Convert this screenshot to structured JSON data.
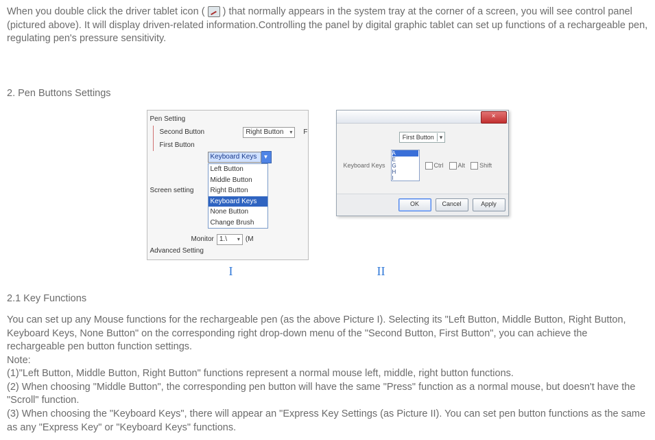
{
  "intro": {
    "part1": "When you double click the driver tablet icon (",
    "part2": ") that normally appears in the system tray at the corner of a screen, you will see control panel (pictured above). It will display driven-related information.Controlling the panel by digital graphic tablet can set up functions of a rechargeable pen, regulating pen's pressure sensitivity."
  },
  "section2_heading": "2. Pen Buttons Settings",
  "figureI": {
    "pen_setting": "Pen Setting",
    "second_button": "Second Button",
    "first_button": "First Button",
    "screen_setting": "Screen setting",
    "advanced_setting": "Advanced Setting",
    "monitor_label": "Monitor",
    "monitor_value": "1.\\",
    "monitor_suffix": "(M",
    "right_trail": "F",
    "second_value": "Right Button",
    "first_value": "Keyboard Keys",
    "options": {
      "o1": "Left Button",
      "o2": "Middle Button",
      "o3": "Right Button",
      "o4": "Keyboard Keys",
      "o5": "None Button",
      "o6": "Change Brush"
    }
  },
  "figureII": {
    "first_button_label": "First Button",
    "keyboard_keys_label": "Keyboard Keys",
    "keylist": {
      "k1": "A",
      "k2": "E",
      "k3": "G",
      "k4": "H",
      "k5": "I"
    },
    "ctrl": "Ctrl",
    "alt": "Alt",
    "shift": "Shift",
    "ok": "OK",
    "cancel": "Cancel",
    "apply": "Apply",
    "close": "×"
  },
  "fig_label_I": "I",
  "fig_label_II": "II",
  "subsection_heading": "2.1  Key Functions",
  "body": {
    "p1": "You can set up any Mouse functions for the rechargeable pen (as the above Picture I). Selecting its \"Left Button, Middle Button, Right Button, Keyboard Keys, None Button\" on the corresponding right drop-down menu of the \"Second Button, First Button\", you can achieve the rechargeable pen button function settings.",
    "note": "Note:",
    "n1": "(1)\"Left Button, Middle Button, Right Button\" functions represent a normal mouse left, middle, right button functions.",
    "n2": "(2) When choosing \"Middle Button\", the corresponding pen button will have the same \"Press\" function as a normal mouse, but doesn't have the \"Scroll\" function.",
    "n3": "(3) When choosing the \"Keyboard Keys\", there will appear an \"Express Key Settings (as Picture II). You can set pen button functions as the same as any \"Express Key\" or \"Keyboard Keys\" functions."
  }
}
